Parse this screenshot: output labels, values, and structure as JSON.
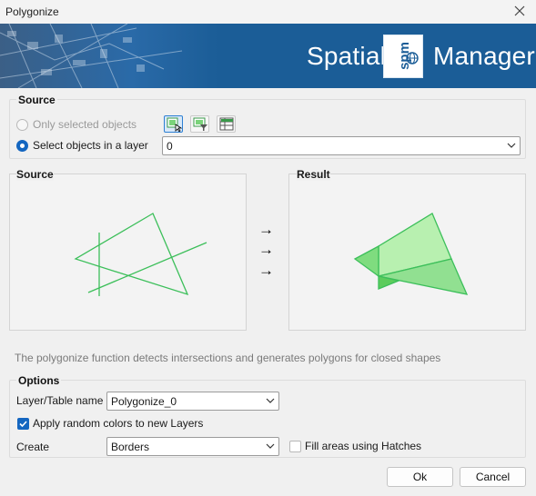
{
  "window": {
    "title": "Polygonize"
  },
  "banner": {
    "brand_left": "Spatial",
    "brand_logo": "spm",
    "brand_right": "Manager"
  },
  "source": {
    "title": "Source",
    "option_selected": "Only selected objects",
    "option_layer": "Select objects in a layer",
    "selected_option": "layer",
    "layer_value": "0",
    "tool_icons": [
      "select-objects-icon",
      "filter-select-icon",
      "select-table-icon"
    ]
  },
  "preview": {
    "source_label": "Source",
    "result_label": "Result",
    "arrows": [
      "→",
      "→",
      "→"
    ],
    "line_color": "#3cbf5a",
    "fill_light": "#b8f0b0",
    "fill_dark": "#7fdc7f"
  },
  "description": "The polygonize function detects intersections and generates polygons for closed shapes",
  "options": {
    "title": "Options",
    "layer_name_label": "Layer/Table name",
    "layer_name_value": "Polygonize_0",
    "random_colors_label": "Apply random colors to new Layers",
    "random_colors_checked": true,
    "create_label": "Create",
    "create_value": "Borders",
    "hatches_label": "Fill areas using Hatches",
    "hatches_checked": false
  },
  "buttons": {
    "ok": "Ok",
    "cancel": "Cancel"
  },
  "colors": {
    "accent": "#1466c0",
    "banner": "#1b5d97"
  }
}
